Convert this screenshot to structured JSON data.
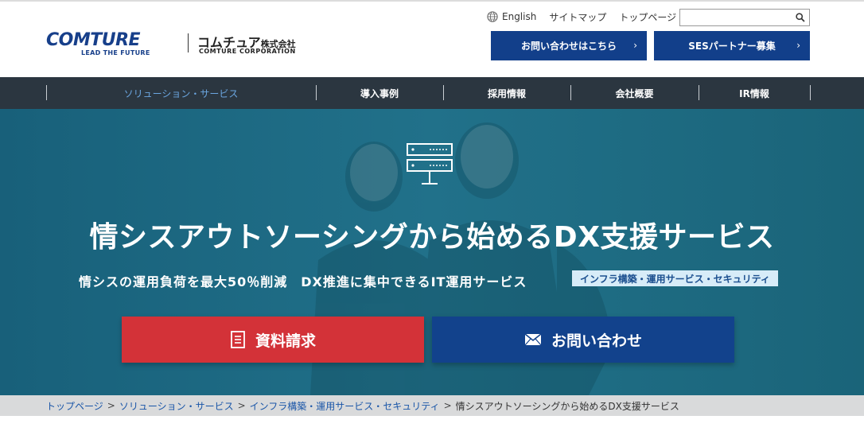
{
  "header": {
    "logo": {
      "word": "COMTURE",
      "tagline": "LEAD THE FUTURE",
      "jp_name": "コムチュア",
      "jp_suffix": "株式会社",
      "en_name": "COMTURE CORPORATION"
    },
    "utility": {
      "english": "English",
      "sitemap": "サイトマップ",
      "toppage": "トップページ"
    },
    "search": {
      "placeholder": ""
    },
    "buttons": {
      "contact": "お問い合わせはこちら",
      "ses": "SESパートナー募集",
      "chevron": "›"
    }
  },
  "nav": {
    "items": [
      {
        "label": "ソリューション・サービス",
        "active": true
      },
      {
        "label": "導入事例",
        "active": false
      },
      {
        "label": "採用情報",
        "active": false
      },
      {
        "label": "会社概要",
        "active": false
      },
      {
        "label": "IR情報",
        "active": false
      }
    ]
  },
  "hero": {
    "title": "情シスアウトソーシングから始めるDX支援サービス",
    "subtitle": "情シスの運用負荷を最大50％削減　DX推進に集中できるIT運用サービス",
    "tag": "インフラ構築・運用サービス・セキュリティ",
    "cta_document": "資料請求",
    "cta_contact": "お問い合わせ"
  },
  "breadcrumb": {
    "items": [
      "トップページ",
      "ソリューション・サービス",
      "インフラ構築・運用サービス・セキュリティ"
    ],
    "current": "情シスアウトソーシングから始めるDX支援サービス",
    "separator": ">"
  },
  "colors": {
    "brand_blue": "#123f8a",
    "nav_bg": "#2b3640",
    "hero_bg": "#1d6a80",
    "cta_red": "#d33238",
    "link": "#1a56a8"
  }
}
